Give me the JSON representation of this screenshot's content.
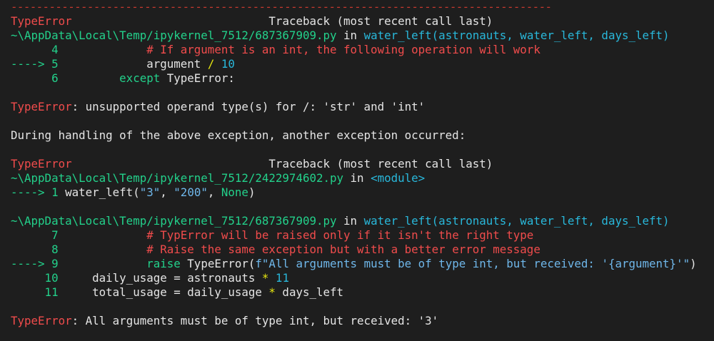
{
  "separator": "-------------------------------------------------------------------------------------",
  "tb1": {
    "error_type": "TypeError",
    "header_pad": "                             ",
    "header": "Traceback (most recent call last)",
    "path": "~\\AppData\\Local\\Temp/ipykernel_7512/687367909.py",
    "in_kw": " in ",
    "func_sig": "water_left(astronauts, water_left, days_left)",
    "l4_no": "      4",
    "l4_code": "             # If argument is an int, the following operation will work",
    "l5_arrow": "----> 5",
    "l5_code_a": "             argument ",
    "l5_op": "/",
    "l5_num": " 10",
    "l6_no": "      6",
    "l6_kw": "         except",
    "l6_rest": " TypeError:"
  },
  "msg1": {
    "error_type": "TypeError",
    "text": ": unsupported operand type(s) for /: 'str' and 'int'"
  },
  "during": "During handling of the above exception, another exception occurred:",
  "tb2": {
    "error_type": "TypeError",
    "header_pad": "                             ",
    "header": "Traceback (most recent call last)",
    "path": "~\\AppData\\Local\\Temp/ipykernel_7512/2422974602.py",
    "in_kw": " in ",
    "module": "<module>",
    "l1_arrow": "----> 1",
    "l1_call": " water_left(",
    "l1_arg1": "\"3\"",
    "l1_comma1": ", ",
    "l1_arg2": "\"200\"",
    "l1_comma2": ", ",
    "l1_arg3": "None",
    "l1_close": ")"
  },
  "tb3": {
    "path": "~\\AppData\\Local\\Temp/ipykernel_7512/687367909.py",
    "in_kw": " in ",
    "func_sig": "water_left(astronauts, water_left, days_left)",
    "l7_no": "      7",
    "l7_code": "             # TypError will be raised only if it isn't the right type",
    "l8_no": "      8",
    "l8_code": "             # Raise the same exception but with a better error message",
    "l9_arrow": "----> 9",
    "l9_raise": "             raise",
    "l9_cls": " TypeError",
    "l9_paren": "(",
    "l9_str": "f\"All arguments must be of type int, but received: '{argument}'\"",
    "l9_close": ")",
    "l10_no": "     10",
    "l10_code": "     daily_usage = astronauts ",
    "l10_op": "*",
    "l10_num": " 11",
    "l11_no": "     11",
    "l11_code": "     total_usage = daily_usage ",
    "l11_op": "*",
    "l11_rest": " days_left"
  },
  "msg2": {
    "error_type": "TypeError",
    "text": ": All arguments must be of type int, but received: '3'"
  },
  "colors": {
    "background": "#1e1e1e",
    "error_red": "#f14c4c",
    "path_green": "#23d18b",
    "func_blue": "#3b8eea",
    "number_cyan": "#29b8db",
    "operator_yellow": "#e5e510"
  }
}
